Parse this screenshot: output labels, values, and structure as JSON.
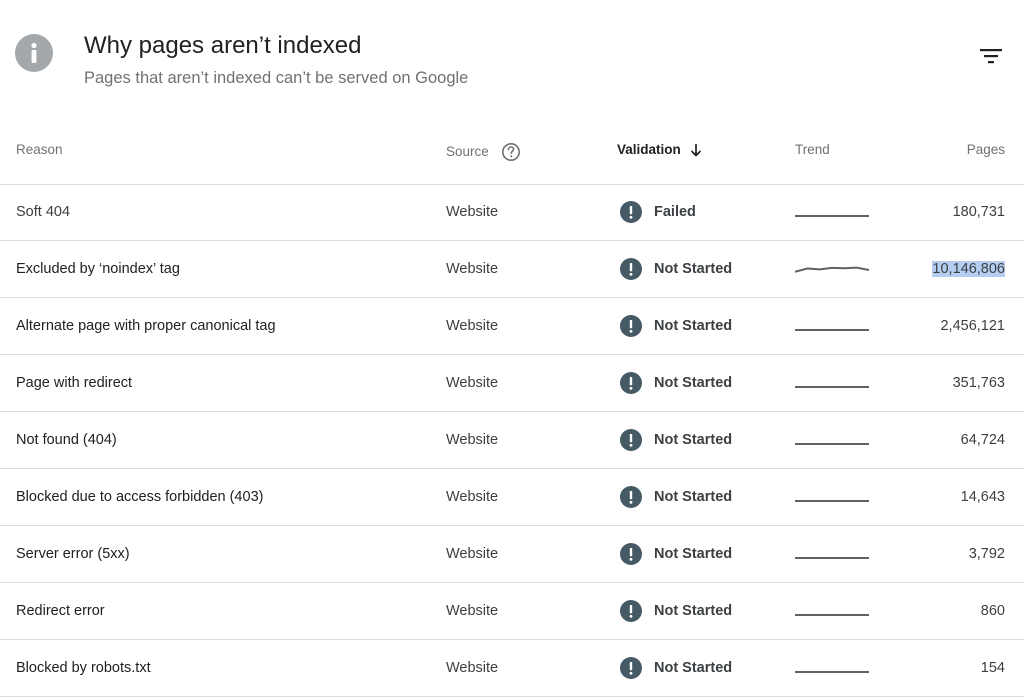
{
  "header": {
    "title": "Why pages aren’t indexed",
    "subtitle": "Pages that aren’t indexed can’t be served on Google"
  },
  "columns": {
    "reason": "Reason",
    "source": "Source",
    "validation": "Validation",
    "trend": "Trend",
    "pages": "Pages"
  },
  "colors": {
    "status_icon": "#455a64",
    "trend_line": "#5f6368",
    "selection_highlight": "#b4cdf0"
  },
  "rows": [
    {
      "reason": "Soft 404",
      "source": "Website",
      "validation": "Failed",
      "pages": "180,731",
      "trend": [
        0,
        0,
        0,
        0,
        0,
        0,
        0
      ]
    },
    {
      "reason": "Excluded by ‘noindex’ tag",
      "source": "Website",
      "validation": "Not Started",
      "pages": "10,146,806",
      "trend": [
        0.2,
        0.75,
        0.6,
        0.85,
        0.8,
        0.9,
        0.5
      ],
      "selected": true
    },
    {
      "reason": "Alternate page with proper canonical tag",
      "source": "Website",
      "validation": "Not Started",
      "pages": "2,456,121",
      "trend": [
        0,
        0,
        0,
        0,
        0,
        0,
        0
      ]
    },
    {
      "reason": "Page with redirect",
      "source": "Website",
      "validation": "Not Started",
      "pages": "351,763",
      "trend": [
        0,
        0,
        0,
        0,
        0,
        0,
        0
      ]
    },
    {
      "reason": "Not found (404)",
      "source": "Website",
      "validation": "Not Started",
      "pages": "64,724",
      "trend": [
        0,
        0,
        0,
        0,
        0,
        0,
        0
      ]
    },
    {
      "reason": "Blocked due to access forbidden (403)",
      "source": "Website",
      "validation": "Not Started",
      "pages": "14,643",
      "trend": [
        0,
        0,
        0,
        0,
        0,
        0,
        0
      ]
    },
    {
      "reason": "Server error (5xx)",
      "source": "Website",
      "validation": "Not Started",
      "pages": "3,792",
      "trend": [
        0,
        0,
        0,
        0,
        0,
        0,
        0
      ]
    },
    {
      "reason": "Redirect error",
      "source": "Website",
      "validation": "Not Started",
      "pages": "860",
      "trend": [
        0,
        0,
        0,
        0,
        0,
        0,
        0
      ]
    },
    {
      "reason": "Blocked by robots.txt",
      "source": "Website",
      "validation": "Not Started",
      "pages": "154",
      "trend": [
        0,
        0,
        0,
        0,
        0,
        0,
        0
      ]
    }
  ],
  "icons": {
    "header": "info-icon",
    "filter": "filter-icon",
    "source_help": "help-circle-icon",
    "sort": "arrow-down-icon",
    "status": "exclamation-circle-icon"
  }
}
